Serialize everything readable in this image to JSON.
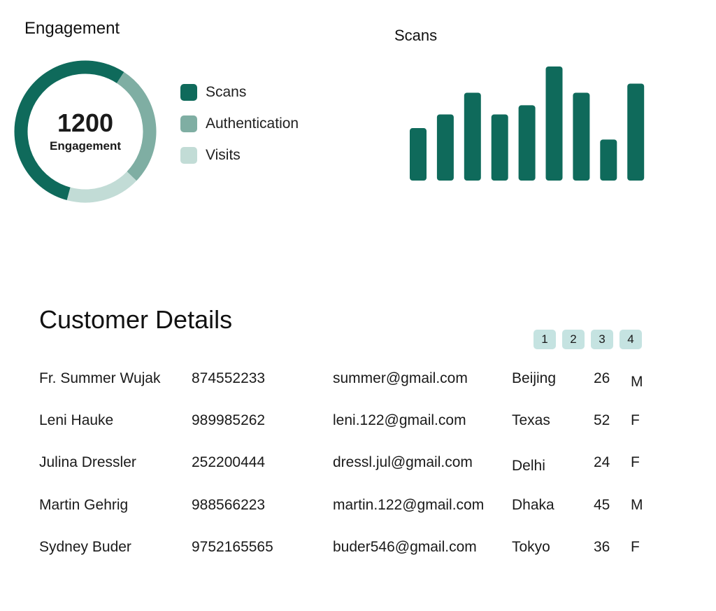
{
  "engagement": {
    "title": "Engagement",
    "total": "1200",
    "total_label": "Engagement",
    "legend": [
      {
        "label": "Scans",
        "color": "#0f6a5b"
      },
      {
        "label": "Authentication",
        "color": "#7faea3"
      },
      {
        "label": "Visits",
        "color": "#c2dcd6"
      }
    ],
    "segments": [
      {
        "name": "Scans",
        "fraction": 0.55,
        "color": "#0f6a5b"
      },
      {
        "name": "Authentication",
        "fraction": 0.28,
        "color": "#7faea3"
      },
      {
        "name": "Visits",
        "fraction": 0.17,
        "color": "#c2dcd6"
      }
    ]
  },
  "scans": {
    "title": "Scans"
  },
  "chart_data": {
    "type": "bar",
    "title": "Scans",
    "categories": [
      "",
      "",
      "",
      "",
      "",
      "",
      "",
      "",
      ""
    ],
    "values": [
      46,
      58,
      77,
      58,
      66,
      100,
      77,
      36,
      85
    ],
    "ylim": [
      0,
      100
    ],
    "color": "#0f6a5b",
    "grid": false
  },
  "customers": {
    "title": "Customer Details",
    "pages": [
      "1",
      "2",
      "3",
      "4"
    ],
    "rows": [
      {
        "name": "Fr. Summer Wujak",
        "phone": "874552233",
        "email": "summer@gmail.com",
        "city": "Beijing",
        "age": "26",
        "gender": "M"
      },
      {
        "name": "Leni Hauke",
        "phone": "989985262",
        "email": "leni.122@gmail.com",
        "city": "Texas",
        "age": "52",
        "gender": "F"
      },
      {
        "name": "Julina Dressler",
        "phone": "252200444",
        "email": "dressl.jul@gmail.com",
        "city": "Delhi",
        "age": "24",
        "gender": "F"
      },
      {
        "name": "Martin Gehrig",
        "phone": "988566223",
        "email": "martin.122@gmail.com",
        "city": "Dhaka",
        "age": "45",
        "gender": "M"
      },
      {
        "name": "Sydney Buder",
        "phone": "9752165565",
        "email": "buder546@gmail.com",
        "city": "Tokyo",
        "age": "36",
        "gender": "F"
      }
    ]
  }
}
